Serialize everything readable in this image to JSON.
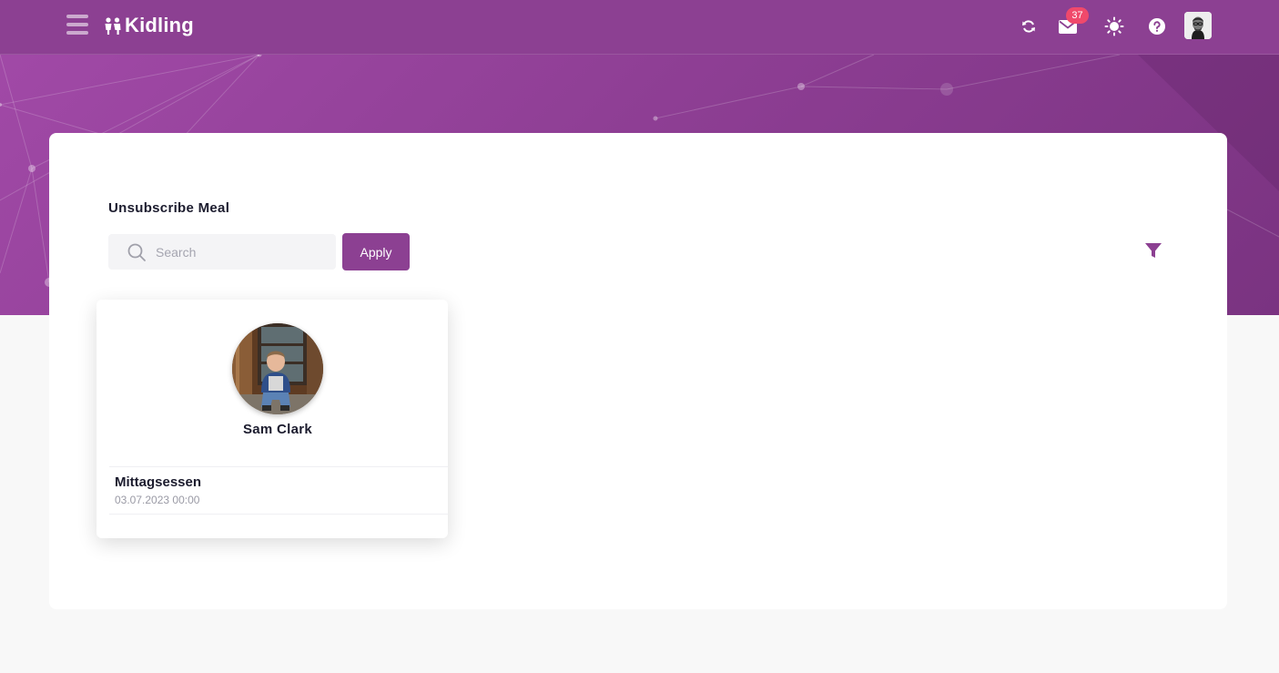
{
  "app": {
    "name": "Kidling"
  },
  "topbar": {
    "menu_icon": "hamburger-menu-icon",
    "icons": [
      "refresh-icon",
      "mail-icon",
      "sun-icon",
      "help-icon"
    ],
    "mail_badge": "37",
    "colors": {
      "brand": "#8c4092",
      "badge": "#f0496b"
    }
  },
  "page": {
    "title": "Unsubscribe Meal",
    "search": {
      "placeholder": "Search",
      "value": ""
    },
    "apply_label": "Apply",
    "filter_icon": "filter-icon"
  },
  "children": [
    {
      "name": "Sam Clark",
      "meals": [
        {
          "name": "Mittagsessen",
          "date": "03.07.2023 00:00"
        }
      ]
    }
  ]
}
